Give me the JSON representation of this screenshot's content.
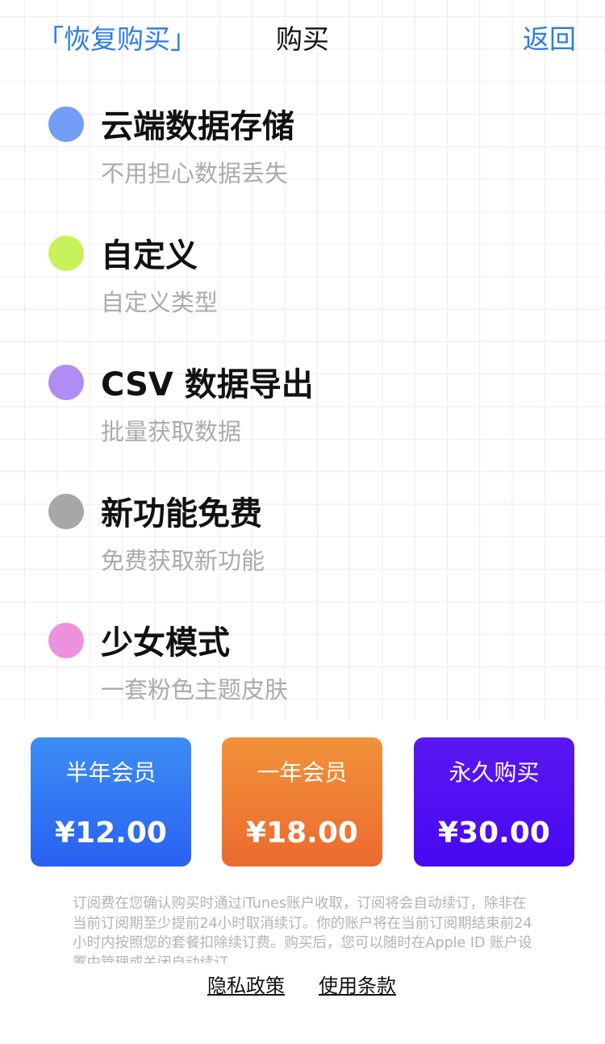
{
  "nav": {
    "restore": "「恢复购买」",
    "title": "购买",
    "back": "返回"
  },
  "features": [
    {
      "title": "云端数据存储",
      "subtitle": "不用担心数据丢失",
      "color": "#739df6"
    },
    {
      "title": "自定义",
      "subtitle": "自定义类型",
      "color": "#c8f25a"
    },
    {
      "title": "CSV 数据导出",
      "subtitle": "批量获取数据",
      "color": "#b08cf5"
    },
    {
      "title": "新功能免费",
      "subtitle": "免费获取新功能",
      "color": "#a7a7a7"
    },
    {
      "title": "少女模式",
      "subtitle": "一套粉色主题皮肤",
      "color": "#ee91dc"
    }
  ],
  "plans": [
    {
      "name": "半年会员",
      "price": "¥12.00",
      "color": "#2f6ff3"
    },
    {
      "name": "一年会员",
      "price": "¥18.00",
      "color": "#ee7a33"
    },
    {
      "name": "永久购买",
      "price": "¥30.00",
      "color": "#4f10f2"
    }
  ],
  "terms": "订阅费在您确认购买时通过iTunes账户收取，订阅将会自动续订，除非在当前订阅期至少提前24小时取消续订。你的账户将在当前订阅期结束前24小时内按照您的套餐扣除续订费。购买后，您可以随时在Apple ID 账户设置中管理或关闭自动续订。",
  "links": {
    "privacy": "隐私政策",
    "terms_of_use": "使用条款"
  }
}
